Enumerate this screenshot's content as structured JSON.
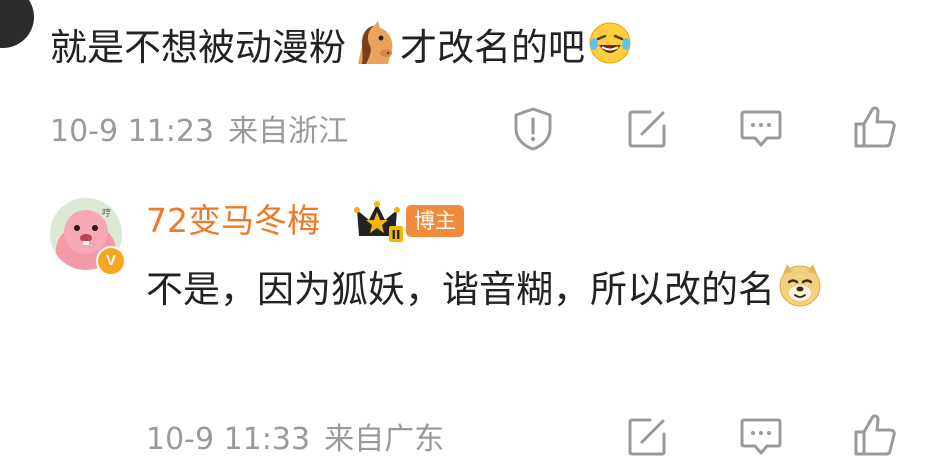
{
  "comment": {
    "text_before_emoji": "就是不想被动漫粉",
    "emoji_1": "horse-emoji",
    "text_after_emoji": "才改名的吧",
    "emoji_2": "laugh-cry-emoji",
    "time": "10-9 11:23",
    "location": "来自浙江"
  },
  "reply": {
    "username": "72变马冬梅",
    "badge_label": "博主",
    "badge_level": "II",
    "text": "不是，因为狐妖，谐音糊，所以改的名",
    "emoji": "doge-emoji",
    "time": "10-9 11:33",
    "location": "来自广东"
  },
  "icons": {
    "report": "report-icon",
    "share": "share-icon",
    "comment": "comment-icon",
    "like": "like-icon"
  },
  "colors": {
    "username": "#ee7a27",
    "badge": "#f18a3a",
    "meta": "#9a9a9a",
    "text": "#222222"
  }
}
